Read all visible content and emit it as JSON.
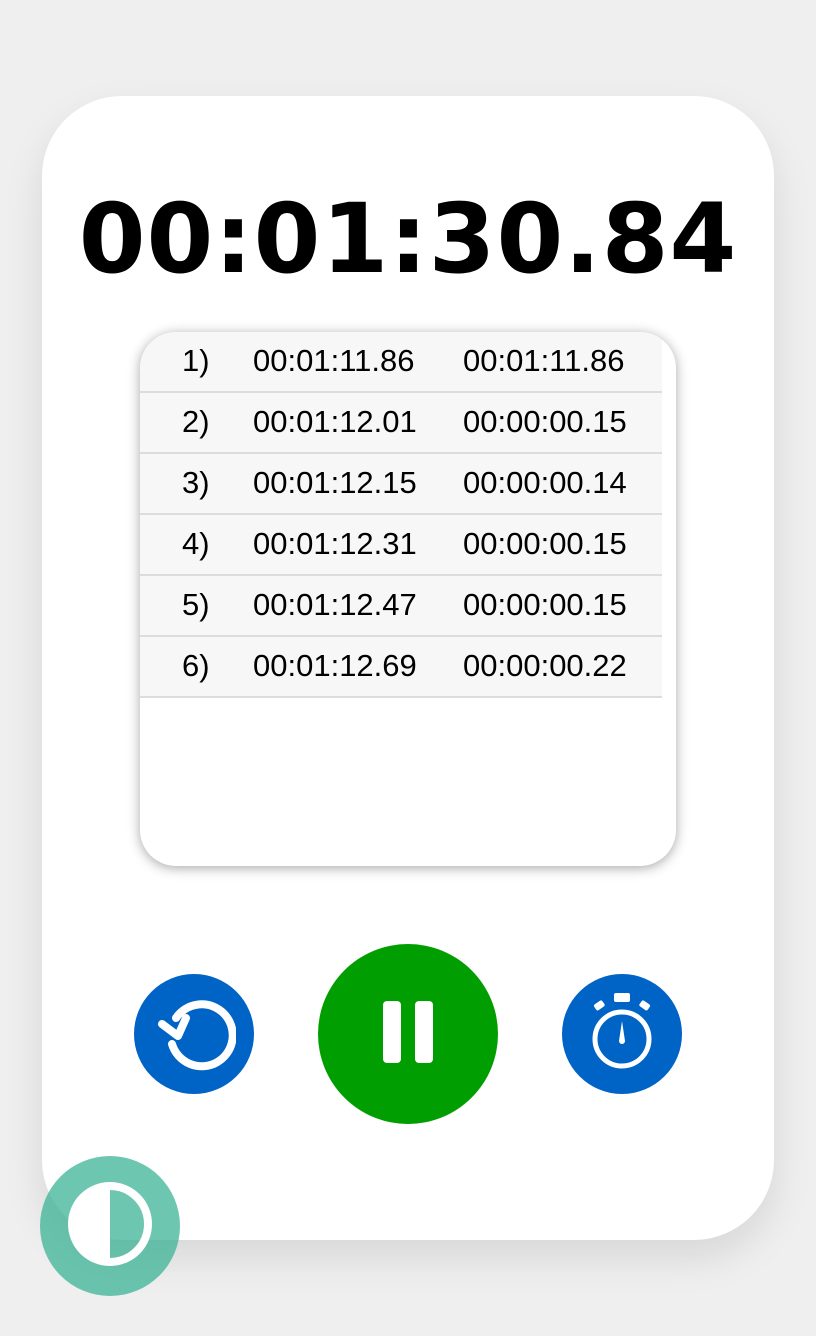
{
  "timer": {
    "display": "00:01:30.84"
  },
  "laps": [
    {
      "num": "1)",
      "total": "00:01:11.86",
      "split": "00:01:11.86"
    },
    {
      "num": "2)",
      "total": "00:01:12.01",
      "split": "00:00:00.15"
    },
    {
      "num": "3)",
      "total": "00:01:12.15",
      "split": "00:00:00.14"
    },
    {
      "num": "4)",
      "total": "00:01:12.31",
      "split": "00:00:00.15"
    },
    {
      "num": "5)",
      "total": "00:01:12.47",
      "split": "00:00:00.15"
    },
    {
      "num": "6)",
      "total": "00:01:12.69",
      "split": "00:00:00.22"
    }
  ],
  "controls": {
    "reset_icon": "reset-icon",
    "pause_icon": "pause-icon",
    "lap_icon": "stopwatch-icon",
    "theme_icon": "contrast-icon"
  },
  "colors": {
    "primary_button": "#0063c6",
    "pause_button": "#009e00",
    "theme_toggle": "#3cb496"
  }
}
